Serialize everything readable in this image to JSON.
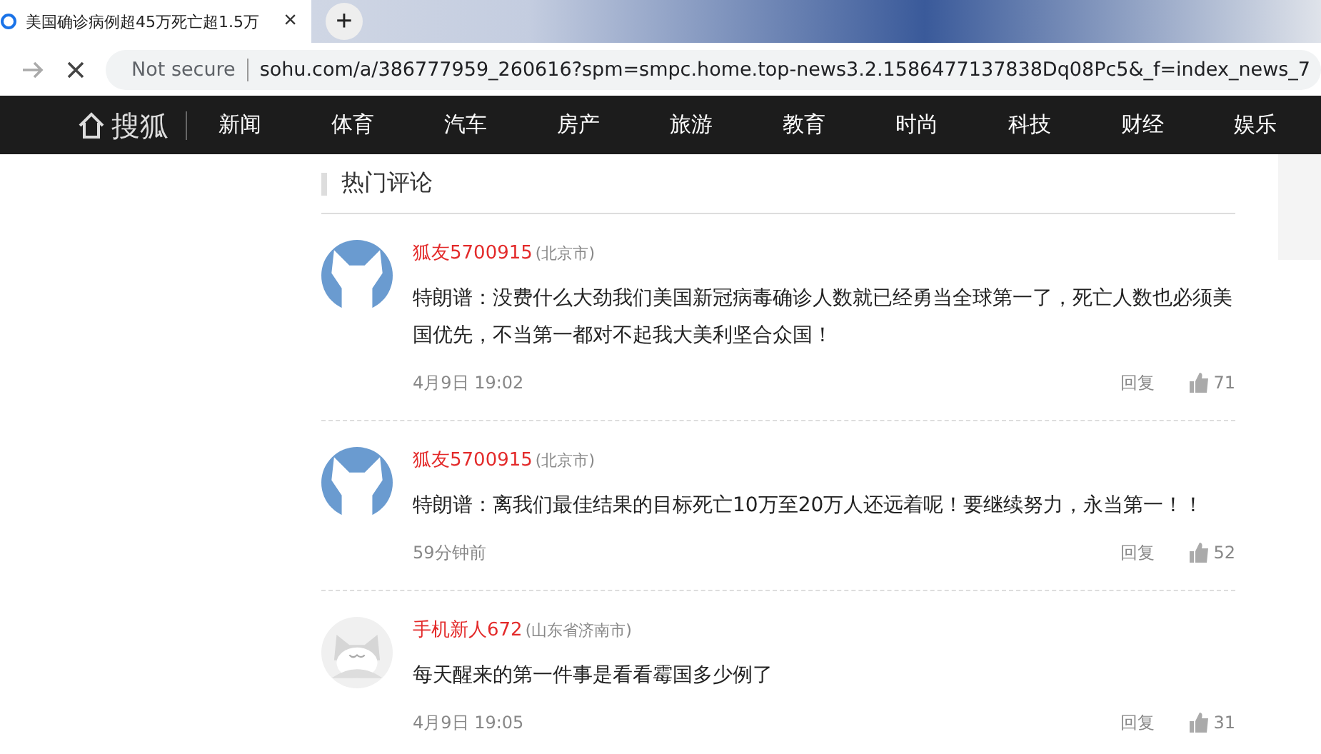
{
  "browser": {
    "tab_title": "美国确诊病例超45万死亡超1.5万",
    "new_tab": "+",
    "close": "×",
    "security": "Not secure",
    "url": "sohu.com/a/386777959_260616?spm=smpc.home.top-news3.2.1586477137838Dq08Pc5&_f=index_news_7"
  },
  "site": {
    "logo": "搜狐",
    "nav": [
      {
        "label": "新闻"
      },
      {
        "label": "体育"
      },
      {
        "label": "汽车"
      },
      {
        "label": "房产"
      },
      {
        "label": "旅游"
      },
      {
        "label": "教育"
      },
      {
        "label": "时尚"
      },
      {
        "label": "科技"
      },
      {
        "label": "财经"
      },
      {
        "label": "娱乐"
      }
    ]
  },
  "section_title": "热门评论",
  "comments": [
    {
      "kind": "fox",
      "user": "狐友5700915",
      "location": "(北京市)",
      "text": "特朗谱：没费什么大劲我们美国新冠病毒确诊人数就已经勇当全球第一了，死亡人数也必须美国优先，不当第一都对不起我大美利坚合众国！",
      "time": "4月9日 19:02",
      "reply": "回复",
      "likes": "71"
    },
    {
      "kind": "fox",
      "user": "狐友5700915",
      "location": "(北京市)",
      "text": "特朗谱：离我们最佳结果的目标死亡10万至20万人还远着呢！要继续努力，永当第一！！",
      "time": "59分钟前",
      "reply": "回复",
      "likes": "52"
    },
    {
      "kind": "cat",
      "user": "手机新人672",
      "location": "(山东省济南市)",
      "text": "每天醒来的第一件事是看看霉国多少例了",
      "time": "4月9日 19:05",
      "reply": "回复",
      "likes": "31"
    }
  ]
}
